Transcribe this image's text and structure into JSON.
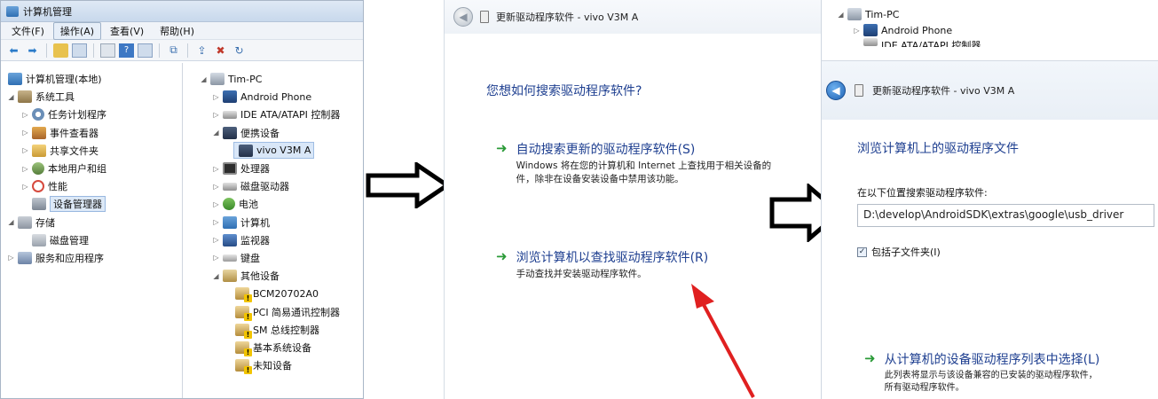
{
  "computer_management": {
    "title": "计算机管理",
    "menus": [
      "文件(F)",
      "操作(A)",
      "查看(V)",
      "帮助(H)"
    ],
    "active_menu_index": 1,
    "left_tree": [
      {
        "label": "计算机管理(本地)",
        "icon": "computer-icon"
      },
      {
        "label": "系统工具",
        "icon": "tools-icon"
      },
      {
        "label": "任务计划程序",
        "icon": "clock-icon"
      },
      {
        "label": "事件查看器",
        "icon": "event-icon"
      },
      {
        "label": "共享文件夹",
        "icon": "folder-icon"
      },
      {
        "label": "本地用户和组",
        "icon": "users-icon"
      },
      {
        "label": "性能",
        "icon": "performance-icon"
      },
      {
        "label": "设备管理器",
        "icon": "device-manager-icon"
      },
      {
        "label": "存储",
        "icon": "storage-icon"
      },
      {
        "label": "磁盘管理",
        "icon": "disk-icon"
      },
      {
        "label": "服务和应用程序",
        "icon": "services-icon"
      }
    ],
    "device_tree": [
      {
        "label": "Tim-PC",
        "icon": "pc-icon"
      },
      {
        "label": "Android Phone",
        "icon": "phone-icon"
      },
      {
        "label": "IDE ATA/ATAPI 控制器",
        "icon": "ide-icon"
      },
      {
        "label": "便携设备",
        "icon": "portable-icon"
      },
      {
        "label": "vivo V3M A",
        "icon": "portable-device-icon"
      },
      {
        "label": "处理器",
        "icon": "cpu-icon"
      },
      {
        "label": "磁盘驱动器",
        "icon": "disk-drive-icon"
      },
      {
        "label": "电池",
        "icon": "battery-icon"
      },
      {
        "label": "计算机",
        "icon": "computer-icon"
      },
      {
        "label": "监视器",
        "icon": "monitor-icon"
      },
      {
        "label": "键盘",
        "icon": "keyboard-icon"
      },
      {
        "label": "其他设备",
        "icon": "other-devices-icon"
      },
      {
        "label": "BCM20702A0",
        "icon": "warning-device-icon"
      },
      {
        "label": "PCI 简易通讯控制器",
        "icon": "warning-device-icon"
      },
      {
        "label": "SM 总线控制器",
        "icon": "warning-device-icon"
      },
      {
        "label": "基本系统设备",
        "icon": "warning-device-icon"
      },
      {
        "label": "未知设备",
        "icon": "warning-device-icon"
      }
    ]
  },
  "wizard_search": {
    "title": "更新驱动程序软件 - vivo V3M A",
    "question": "您想如何搜索驱动程序软件?",
    "option_auto": {
      "title": "自动搜索更新的驱动程序软件(S)",
      "desc1": "Windows 将在您的计算机和 Internet 上查找用于相关设备的",
      "desc2": "件，除非在设备安装设备中禁用该功能。"
    },
    "option_browse": {
      "title": "浏览计算机以查找驱动程序软件(R)",
      "desc": "手动查找并安装驱动程序软件。"
    }
  },
  "wizard_browse": {
    "tree_top": "Tim-PC",
    "tree_phone": "Android Phone",
    "tree_ide": "IDE ATA/ATAPI 控制器",
    "title": "更新驱动程序软件 - vivo V3M A",
    "heading": "浏览计算机上的驱动程序文件",
    "path_label": "在以下位置搜索驱动程序软件:",
    "path_value": "D:\\develop\\AndroidSDK\\extras\\google\\usb_driver",
    "include_subfolders": "包括子文件夹(I)",
    "include_checked": true,
    "pick_list": {
      "title": "从计算机的设备驱动程序列表中选择(L)",
      "desc1": "此列表将显示与该设备兼容的已安装的驱动程序软件，",
      "desc2": "所有驱动程序软件。"
    }
  }
}
